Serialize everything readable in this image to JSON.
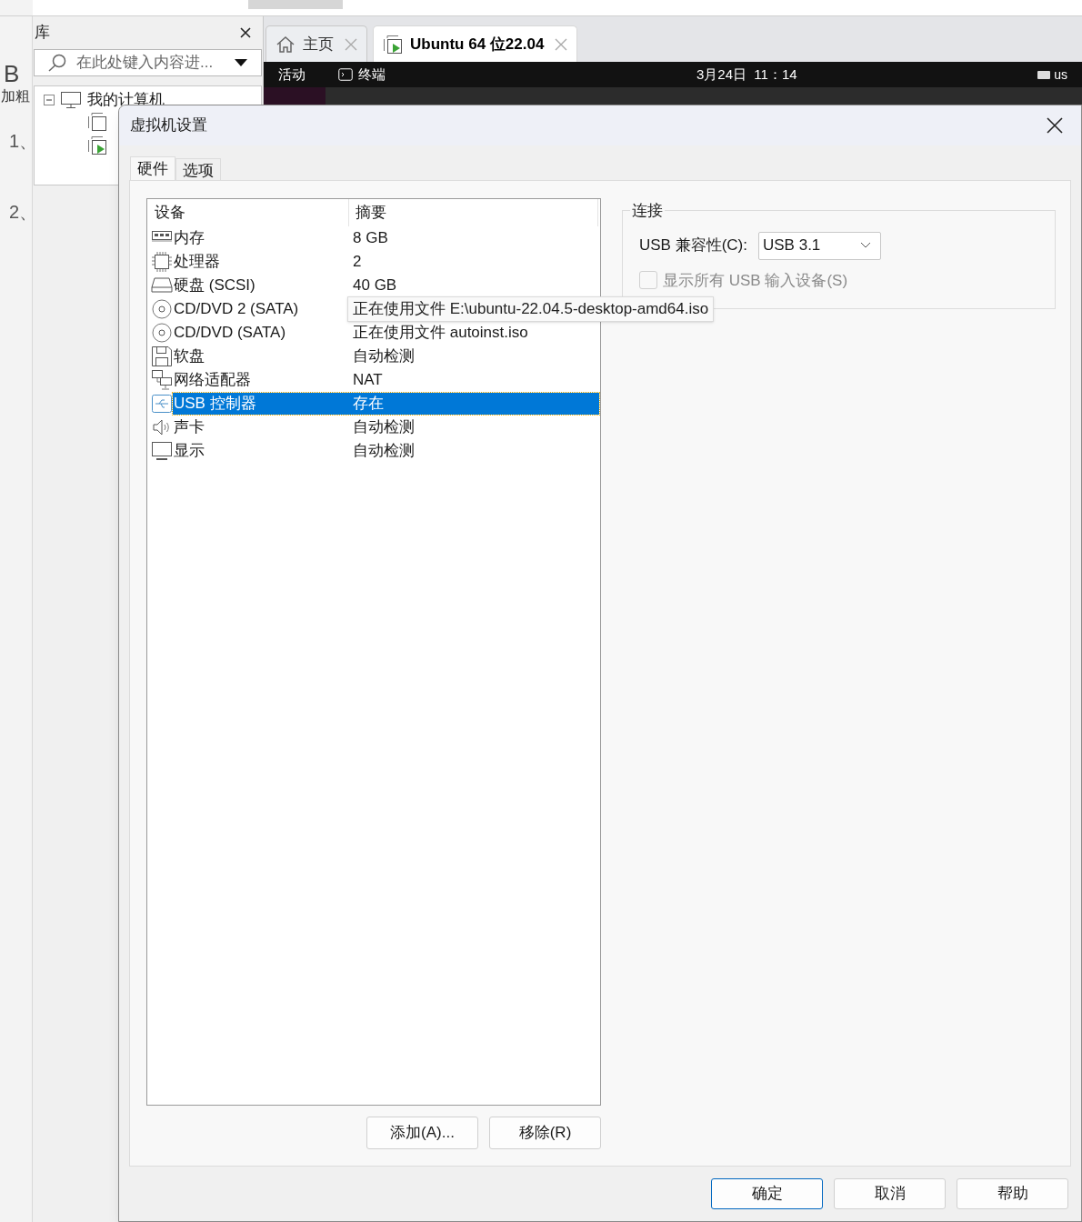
{
  "editor_side": {
    "bold_button": "B",
    "bold_label": "加粗",
    "list_items": [
      "1、",
      "2、"
    ]
  },
  "library": {
    "title": "库",
    "search": {
      "placeholder": "在此处键入内容进..."
    },
    "tree": [
      {
        "label": "我的计算机",
        "expanded": true,
        "children": [
          {
            "running": false
          },
          {
            "running": true
          }
        ]
      }
    ]
  },
  "tabs": [
    {
      "label": "主页",
      "selected": false
    },
    {
      "label": "Ubuntu 64 位22.04",
      "selected": true
    }
  ],
  "guest_topbar": {
    "activities": "活动",
    "app": "终端",
    "clock": "3月24日  11：14",
    "keyboard": "us"
  },
  "dialog": {
    "title": "虚拟机设置",
    "tabs": [
      {
        "label": "硬件",
        "selected": true
      },
      {
        "label": "选项",
        "selected": false
      }
    ],
    "devices": {
      "columns": [
        "设备",
        "摘要"
      ],
      "rows": [
        {
          "kind": "memory",
          "device": "内存",
          "summary": "8 GB",
          "selected": false
        },
        {
          "kind": "cpu",
          "device": "处理器",
          "summary": "2",
          "selected": false
        },
        {
          "kind": "disk",
          "device": "硬盘 (SCSI)",
          "summary": "40 GB",
          "selected": false
        },
        {
          "kind": "cdrom",
          "device": "CD/DVD 2 (SATA)",
          "summary": "正在使用文件 E:\\ubuntu-22.04.5-desktop-amd64.iso",
          "tooltip": true,
          "selected": false
        },
        {
          "kind": "cdrom",
          "device": "CD/DVD (SATA)",
          "summary": "正在使用文件 autoinst.iso",
          "selected": false
        },
        {
          "kind": "floppy",
          "device": "软盘",
          "summary": "自动检测",
          "selected": false
        },
        {
          "kind": "network",
          "device": "网络适配器",
          "summary": "NAT",
          "selected": false
        },
        {
          "kind": "usb",
          "device": "USB 控制器",
          "summary": "存在",
          "selected": true
        },
        {
          "kind": "sound",
          "device": "声卡",
          "summary": "自动检测",
          "selected": false
        },
        {
          "kind": "display",
          "device": "显示",
          "summary": "自动检测",
          "selected": false
        }
      ]
    },
    "list_buttons": [
      "添加(A)...",
      "移除(R)"
    ],
    "connection": {
      "title": "连接",
      "compat_label": "USB 兼容性(C):",
      "compat_value": "USB 3.1",
      "show_all": {
        "label": "显示所有 USB 输入设备(S)",
        "checked": false,
        "disabled": true
      }
    },
    "buttons": [
      {
        "label": "确定",
        "default": true
      },
      {
        "label": "取消",
        "default": false
      },
      {
        "label": "帮助",
        "default": false
      }
    ]
  }
}
